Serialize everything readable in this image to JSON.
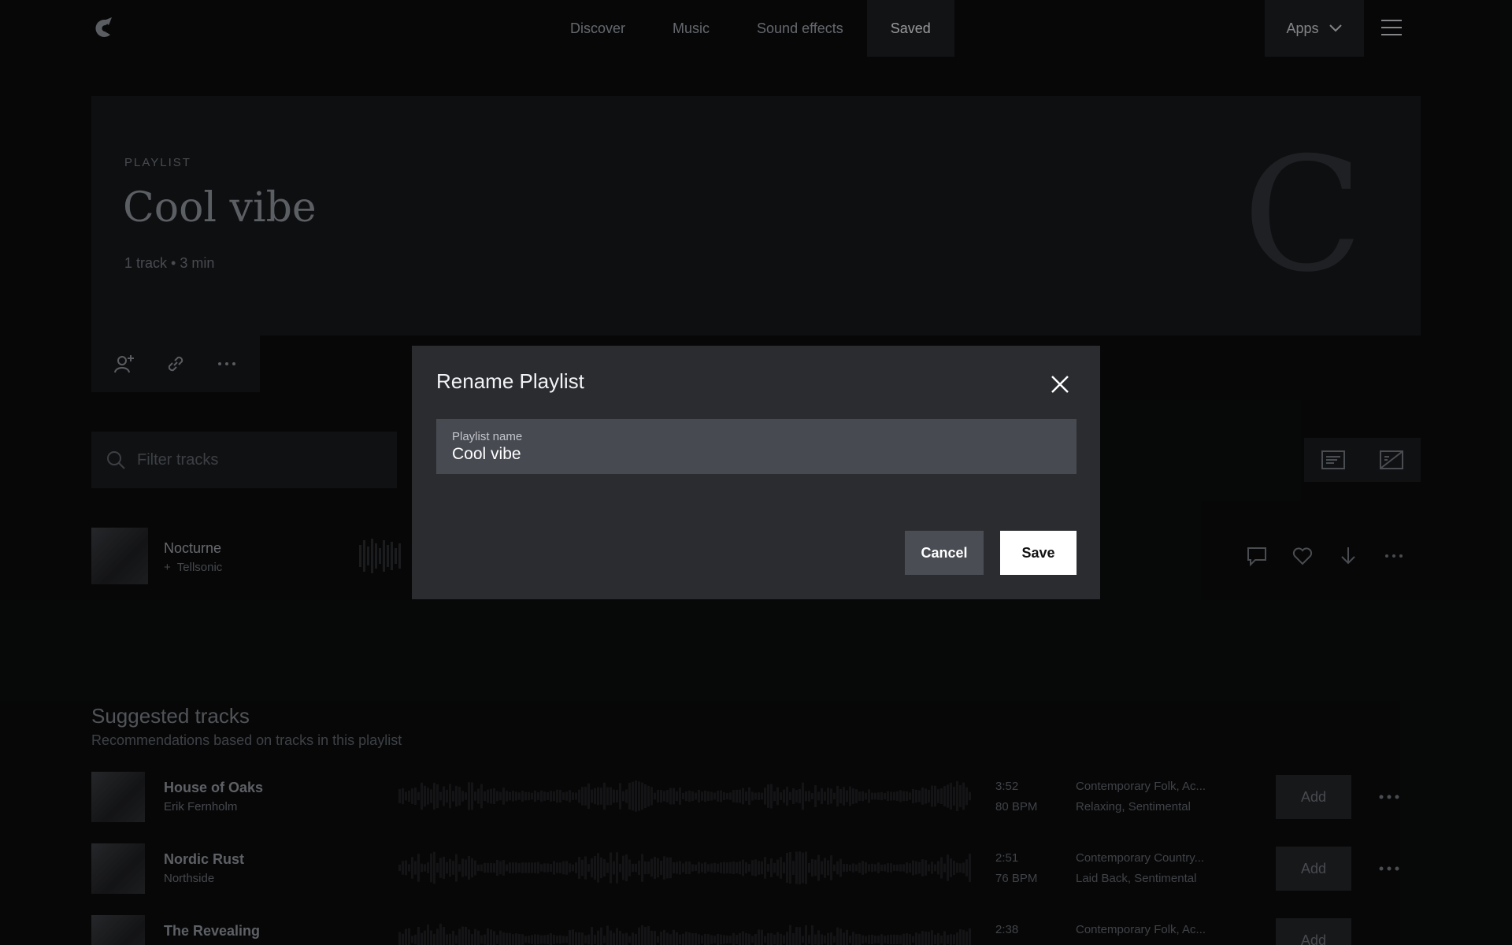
{
  "nav": {
    "items": [
      {
        "label": "Discover"
      },
      {
        "label": "Music"
      },
      {
        "label": "Sound effects"
      },
      {
        "label": "Saved",
        "active": true
      }
    ],
    "apps_label": "Apps"
  },
  "playlist": {
    "label": "PLAYLIST",
    "title": "Cool vibe",
    "meta": "1 track • 3 min",
    "cover_letter": "C"
  },
  "filter": {
    "placeholder": "Filter tracks"
  },
  "tracks": [
    {
      "title": "Nocturne",
      "artist": "Tellsonic"
    }
  ],
  "suggested": {
    "title": "Suggested tracks",
    "subtitle": "Recommendations based on tracks in this playlist",
    "add_label": "Add",
    "rows": [
      {
        "title": "House of Oaks",
        "artist": "Erik Fernholm",
        "duration": "3:52",
        "bpm": "80 BPM",
        "genres": "Contemporary Folk, Ac...",
        "moods": "Relaxing, Sentimental"
      },
      {
        "title": "Nordic Rust",
        "artist": "Northside",
        "duration": "2:51",
        "bpm": "76 BPM",
        "genres": "Contemporary Country...",
        "moods": "Laid Back, Sentimental"
      },
      {
        "title": "The Revealing",
        "artist": "",
        "duration": "2:38",
        "bpm": "",
        "genres": "Contemporary Folk, Ac...",
        "moods": ""
      }
    ]
  },
  "modal": {
    "title": "Rename Playlist",
    "field_label": "Playlist name",
    "field_value": "Cool vibe",
    "cancel_label": "Cancel",
    "save_label": "Save"
  },
  "colors": {
    "background": "#0b0c0d",
    "modal": "#2a2c30",
    "field": "#474a51",
    "save_button": "#ffffff"
  }
}
